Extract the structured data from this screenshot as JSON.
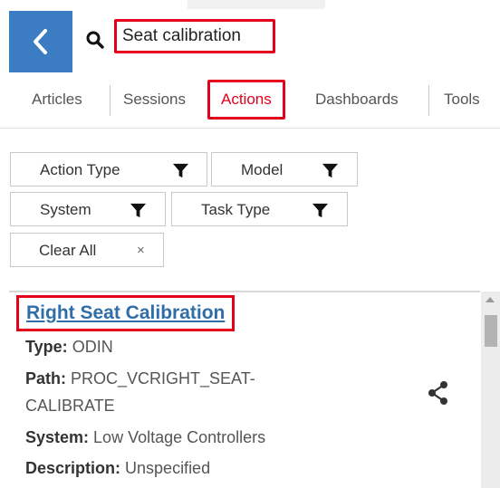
{
  "search": {
    "value": "Seat calibration"
  },
  "tabs": [
    {
      "label": "Articles"
    },
    {
      "label": "Sessions"
    },
    {
      "label": "Actions"
    },
    {
      "label": "Dashboards"
    },
    {
      "label": "Tools"
    }
  ],
  "filters": {
    "action_type": "Action Type",
    "model": "Model",
    "system": "System",
    "task_type": "Task Type",
    "clear_all": "Clear All",
    "clear_x": "×"
  },
  "result": {
    "title": "Right Seat Calibration",
    "type_label": "Type:",
    "type_value": "ODIN",
    "path_label": "Path:",
    "path_value_line1": "PROC_VCRIGHT_SEAT-",
    "path_value_line2": "CALIBRATE",
    "system_label": "System:",
    "system_value": "Low Voltage Controllers",
    "description_label": "Description:",
    "description_value": "Unspecified"
  },
  "colors": {
    "accent": "#3b7cc2",
    "highlight": "#e3001b",
    "link": "#2f6ea8"
  },
  "icons": [
    "back-chevron-icon",
    "search-icon",
    "funnel-icon",
    "share-icon"
  ]
}
